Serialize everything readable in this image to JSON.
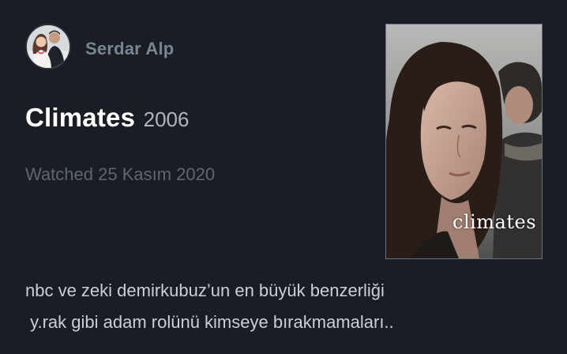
{
  "review": {
    "author": "Serdar Alp",
    "film_title": "Climates",
    "film_year": "2006",
    "watched_label": "Watched",
    "watched_date": "25 Kasım 2020",
    "text_lines": [
      "nbc ve zeki demirkubuz’un en büyük benzerliği",
      " y.rak gibi adam rolünü kimseye bırakmamaları.."
    ]
  },
  "poster": {
    "caption": "climates"
  },
  "icons": {
    "avatar": "user-avatar-photo",
    "poster": "film-poster-image"
  },
  "colors": {
    "background": "#1a1d23",
    "title": "#ffffff",
    "muted": "#5d6672",
    "author": "#7a8594",
    "body_text": "#c9d0d8"
  }
}
